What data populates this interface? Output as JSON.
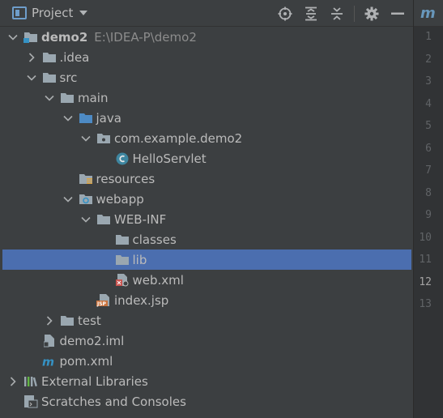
{
  "panel": {
    "title": "Project"
  },
  "tree": [
    {
      "name": "tree-row-demo2",
      "label": "demo2",
      "path": "E:\\IDEA-P\\demo2",
      "bold": true,
      "arrow": "down",
      "icon": "module-folder-icon",
      "depth": 0
    },
    {
      "name": "tree-row-idea",
      "label": ".idea",
      "arrow": "right",
      "icon": "folder-icon",
      "depth": 1
    },
    {
      "name": "tree-row-src",
      "label": "src",
      "arrow": "down",
      "icon": "folder-icon",
      "depth": 1
    },
    {
      "name": "tree-row-main",
      "label": "main",
      "arrow": "down",
      "icon": "folder-icon",
      "depth": 2
    },
    {
      "name": "tree-row-java",
      "label": "java",
      "arrow": "down",
      "icon": "source-folder-icon",
      "depth": 3
    },
    {
      "name": "tree-row-package",
      "label": "com.example.demo2",
      "arrow": "down",
      "icon": "package-icon",
      "depth": 4
    },
    {
      "name": "tree-row-helloservlet",
      "label": "HelloServlet",
      "arrow": "",
      "icon": "class-icon",
      "depth": 5
    },
    {
      "name": "tree-row-resources",
      "label": "resources",
      "arrow": "",
      "icon": "resources-folder-icon",
      "depth": 3
    },
    {
      "name": "tree-row-webapp",
      "label": "webapp",
      "arrow": "down",
      "icon": "web-folder-icon",
      "depth": 3
    },
    {
      "name": "tree-row-web-inf",
      "label": "WEB-INF",
      "arrow": "down",
      "icon": "folder-icon",
      "depth": 4
    },
    {
      "name": "tree-row-classes",
      "label": "classes",
      "arrow": "",
      "icon": "folder-icon",
      "depth": 5
    },
    {
      "name": "tree-row-lib",
      "label": "lib",
      "arrow": "",
      "icon": "folder-icon",
      "depth": 5,
      "selected": true
    },
    {
      "name": "tree-row-web-xml",
      "label": "web.xml",
      "arrow": "",
      "icon": "xml-file-icon",
      "depth": 5
    },
    {
      "name": "tree-row-index-jsp",
      "label": "index.jsp",
      "arrow": "",
      "icon": "jsp-file-icon",
      "depth": 4
    },
    {
      "name": "tree-row-test",
      "label": "test",
      "arrow": "right",
      "icon": "folder-icon",
      "depth": 2
    },
    {
      "name": "tree-row-demo2-iml",
      "label": "demo2.iml",
      "arrow": "",
      "icon": "iml-file-icon",
      "depth": 1
    },
    {
      "name": "tree-row-pom-xml",
      "label": "pom.xml",
      "arrow": "",
      "icon": "maven-icon",
      "depth": 1
    },
    {
      "name": "tree-row-external-libraries",
      "label": "External Libraries",
      "arrow": "right",
      "icon": "libraries-icon",
      "depth": 0
    },
    {
      "name": "tree-row-scratches",
      "label": "Scratches and Consoles",
      "arrow": "",
      "icon": "scratches-icon",
      "depth": 0
    }
  ],
  "toolbar": [
    "locate-icon",
    "expand-all-icon",
    "collapse-all-icon",
    "gear-icon",
    "hide-icon"
  ],
  "editor": {
    "tab_icon": "m",
    "line_numbers": [
      "1",
      "2",
      "3",
      "4",
      "5",
      "6",
      "7",
      "8",
      "9",
      "10",
      "11",
      "12",
      "13"
    ],
    "current_line": "12"
  },
  "colors": {
    "background": "#3c3f41",
    "selection": "#4b6eaf",
    "folder": "#9aa7b0",
    "source_folder": "#4d8ac4",
    "class": "#3e86a0"
  }
}
